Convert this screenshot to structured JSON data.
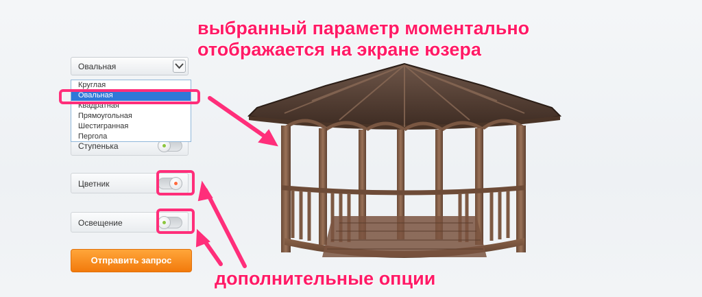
{
  "annotations": {
    "top_line1": "выбранный параметр моментально",
    "top_line2": "отображается на экране юзера",
    "bottom": "дополнительные опции"
  },
  "shape_select": {
    "selected": "Овальная",
    "options": [
      "Круглая",
      "Овальная",
      "Квадратная",
      "Прямоугольная",
      "Шестигранная",
      "Пергола"
    ]
  },
  "options": [
    {
      "label": "Ступенька",
      "on": false
    },
    {
      "label": "Цветник",
      "on": true
    },
    {
      "label": "Освещение",
      "on": false
    }
  ],
  "submit_label": "Отправить запрос",
  "colors": {
    "annotation": "#ff1a66",
    "button": "#f5891f",
    "selected_option": "#2f78d8",
    "toggle_on_dot": "#ff6a3d",
    "toggle_off_dot": "#8cc63f"
  },
  "icons": {
    "select_arrow": "chevron-down-icon",
    "toggle": "toggle-switch-icon",
    "pointer": "arrow-icon"
  }
}
